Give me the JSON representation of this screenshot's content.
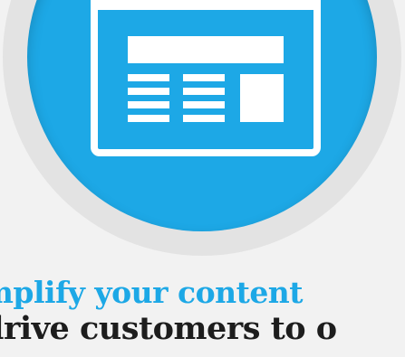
{
  "headline": {
    "line1": "mplify your content",
    "line2": "drive customers to o"
  },
  "colors": {
    "background": "#f2f2f2",
    "ring": "#e3e3e3",
    "accent": "#1da8e6",
    "heading_dark": "#1d1d1d",
    "icon": "#ffffff"
  },
  "icons": {
    "hero": "newspaper-page-icon"
  }
}
